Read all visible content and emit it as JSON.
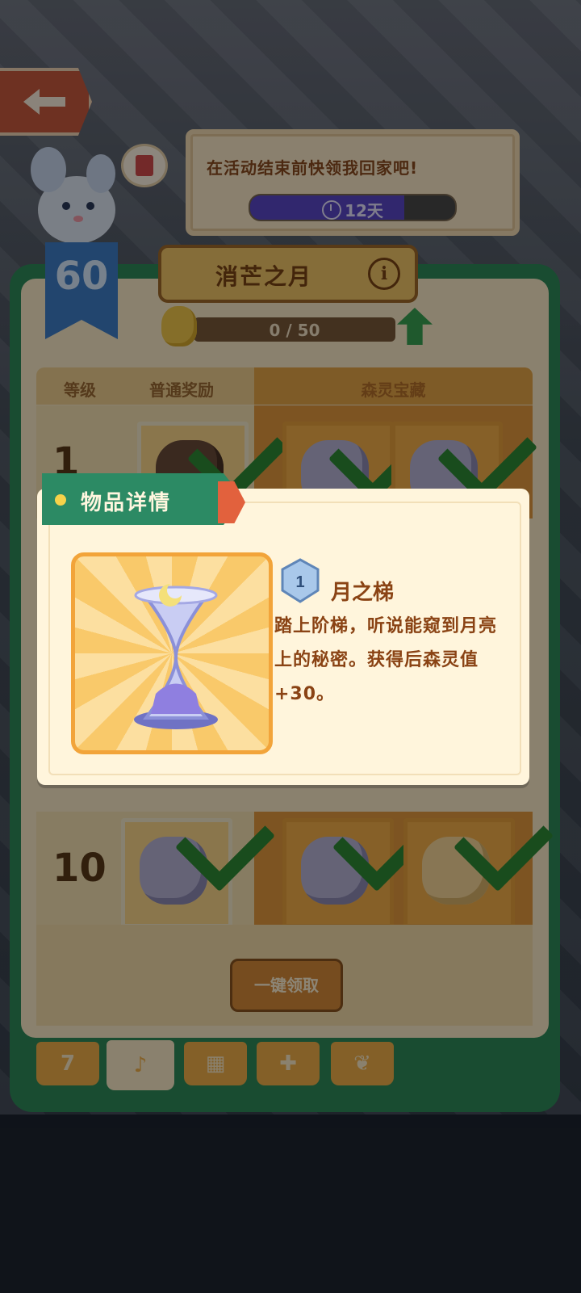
{
  "event": {
    "speech": "在活动结束前快领我回家吧!",
    "timer": "12天",
    "timer_progress": 0.75,
    "level": "60"
  },
  "panel": {
    "title": "消芒之月",
    "progress_text": "0 / 50",
    "columns": [
      "等级",
      "普通奖励",
      "森灵宝藏"
    ],
    "rows": [
      {
        "level": "1"
      },
      {
        "level": "10"
      }
    ],
    "claim_button": "一键领取"
  },
  "modal": {
    "title": "物品详情",
    "item_grade": "1",
    "item_name": "月之梯",
    "item_desc": "踏上阶梯，听说能窥到月亮上的秘密。获得后森灵值+30。"
  },
  "tabs": [
    {
      "icon": "calendar-icon",
      "glyph": "7"
    },
    {
      "icon": "horn-icon",
      "glyph": "♪"
    },
    {
      "icon": "cards-icon",
      "glyph": "▦"
    },
    {
      "icon": "gift-icon",
      "glyph": "✚"
    },
    {
      "icon": "leaf-icon",
      "glyph": "❦"
    }
  ],
  "colors": {
    "panel_green": "#2f8a5a",
    "premium_orange": "#e3993f",
    "text_brown": "#8a4314"
  }
}
